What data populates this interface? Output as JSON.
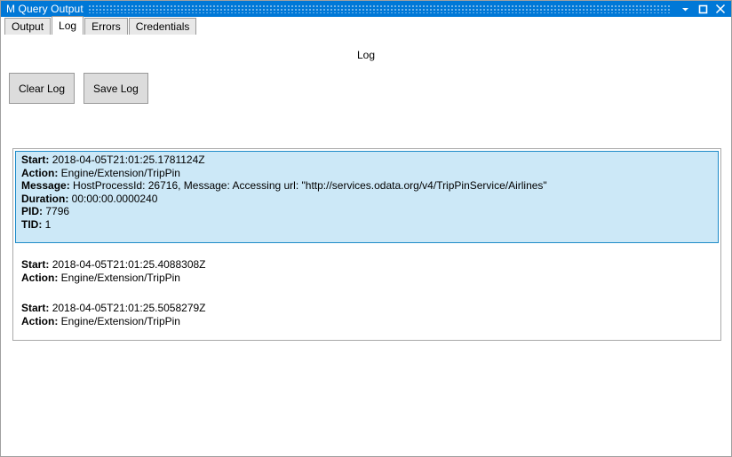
{
  "window": {
    "title": "M Query Output",
    "controls": [
      {
        "name": "minimize-button",
        "glyph": "minimize-icon"
      },
      {
        "name": "maximize-button",
        "glyph": "maximize-icon"
      },
      {
        "name": "close-button",
        "glyph": "close-icon"
      }
    ]
  },
  "tabs": [
    {
      "label": "Output",
      "selected": false
    },
    {
      "label": "Log",
      "selected": true
    },
    {
      "label": "Errors",
      "selected": false
    },
    {
      "label": "Credentials",
      "selected": false
    }
  ],
  "main": {
    "heading": "Log",
    "buttons": {
      "clear_log": "Clear Log",
      "save_log": "Save Log"
    }
  },
  "log_entries": [
    {
      "selected": true,
      "fields": [
        {
          "label": "Start:",
          "value": "2018-04-05T21:01:25.1781124Z"
        },
        {
          "label": "Action:",
          "value": "Engine/Extension/TripPin"
        },
        {
          "label": "Message:",
          "value": "HostProcessId: 26716, Message: Accessing url: \"http://services.odata.org/v4/TripPinService/Airlines\""
        },
        {
          "label": "Duration:",
          "value": "00:00:00.0000240"
        },
        {
          "label": "PID:",
          "value": "7796"
        },
        {
          "label": "TID:",
          "value": "1"
        }
      ]
    },
    {
      "selected": false,
      "fields": [
        {
          "label": "Start:",
          "value": "2018-04-05T21:01:25.4088308Z"
        },
        {
          "label": "Action:",
          "value": "Engine/Extension/TripPin"
        }
      ]
    },
    {
      "selected": false,
      "fields": [
        {
          "label": "Start:",
          "value": "2018-04-05T21:01:25.5058279Z"
        },
        {
          "label": "Action:",
          "value": "Engine/Extension/TripPin"
        }
      ]
    }
  ],
  "colors": {
    "titlebar": "#0078d7",
    "selection_fill": "#cce8f7",
    "selection_border": "#1e8bc8",
    "button_face": "#dcdcdc"
  }
}
